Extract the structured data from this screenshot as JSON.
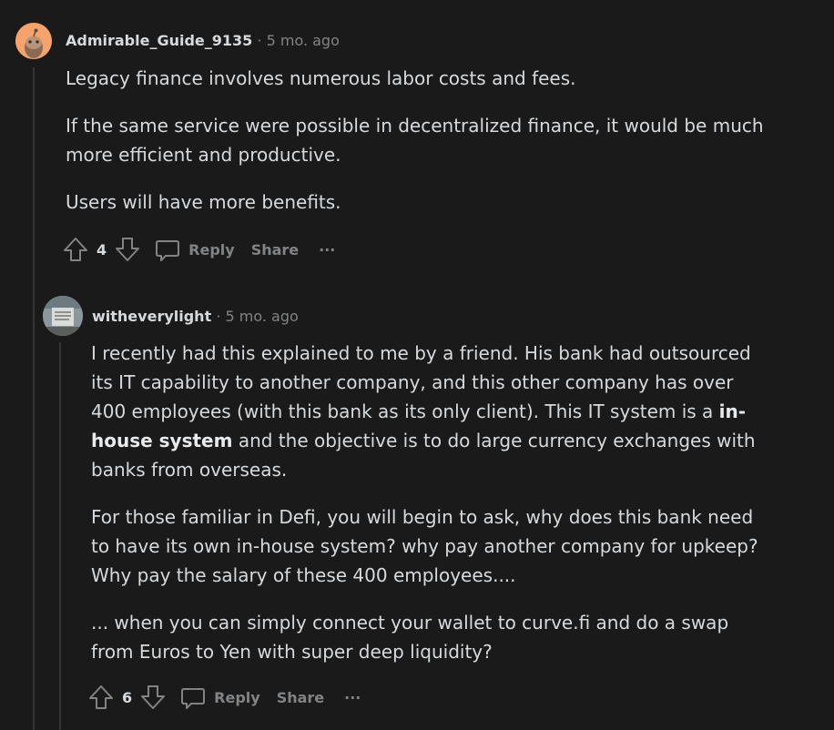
{
  "comments": [
    {
      "username": "Admirable_Guide_9135",
      "separator": "·",
      "time": "5 mo. ago",
      "paragraphs": [
        "Legacy finance involves numerous labor costs and fees.",
        "If the same service were possible in decentralized finance, it would be much more efficient and productive.",
        "Users will have more benefits."
      ],
      "votes": "4",
      "reply_label": "Reply",
      "share_label": "Share",
      "more_label": "···"
    },
    {
      "username": "witheverylight",
      "separator": "·",
      "time": "5 mo. ago",
      "para1_a": "I recently had this explained to me by a friend. His bank had outsourced its IT capability to another company, and this other company has over 400 employees (with this bank as its only client). This IT system is a ",
      "para1_bold": "in-house system",
      "para1_b": " and the objective is to do large currency exchanges with banks from overseas.",
      "paragraphs": [
        "For those familiar in Defi, you will begin to ask, why does this bank need to have its own in-house system? why pay another company for upkeep? Why pay the salary of these 400 employees....",
        "... when you can simply connect your wallet to curve.fi and do a swap from Euros to Yen with super deep liquidity?"
      ],
      "votes": "6",
      "reply_label": "Reply",
      "share_label": "Share",
      "more_label": "···"
    }
  ],
  "colors": {
    "background": "#1a1a1b",
    "text": "#d7dadc",
    "muted": "#818384",
    "avatar1": "#f5a36b"
  }
}
